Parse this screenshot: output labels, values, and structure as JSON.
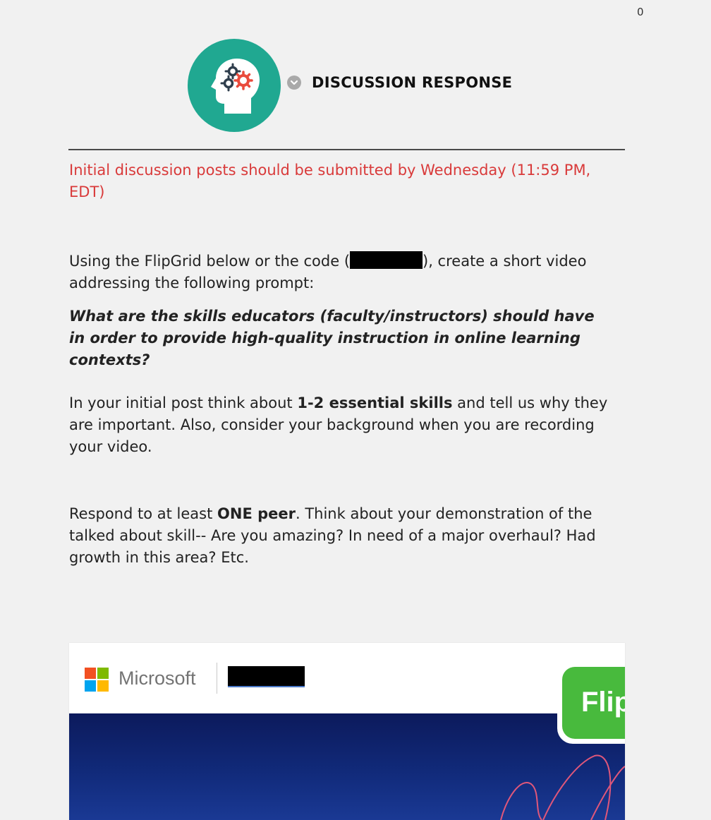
{
  "top_counter": "0",
  "header": {
    "title": "DISCUSSION RESPONSE",
    "icon": "head-gears-icon"
  },
  "deadline": "Initial discussion posts should be submitted by Wednesday (11:59 PM, EDT)",
  "instructions": {
    "before_code": "Using the FlipGrid below or the  code (",
    "after_code": "), create a short video addressing the following prompt:"
  },
  "prompt": "What are the skills educators (faculty/instructors) should have in order to provide high-quality instruction in online learning contexts?",
  "initial_post": {
    "before": "In your initial post think about ",
    "bold": "1-2 essential skills",
    "after": " and tell us why they are important. Also, consider your background when you are recording your video."
  },
  "respond": {
    "before": "Respond to at least ",
    "bold": "ONE peer",
    "after": ". Think about your demonstration of the talked about skill-- Are you amazing? In need of a major overhaul? Had growth in this area? Etc."
  },
  "embed": {
    "brand": "Microsoft",
    "app_badge": "Flip",
    "logo_colors": [
      "#f25022",
      "#7fba00",
      "#00a4ef",
      "#ffb900"
    ]
  },
  "colors": {
    "deadline_red": "#d93a3a",
    "icon_teal": "#20a891",
    "flip_green": "#48ba3d",
    "video_navy": "#0c1a5c"
  }
}
